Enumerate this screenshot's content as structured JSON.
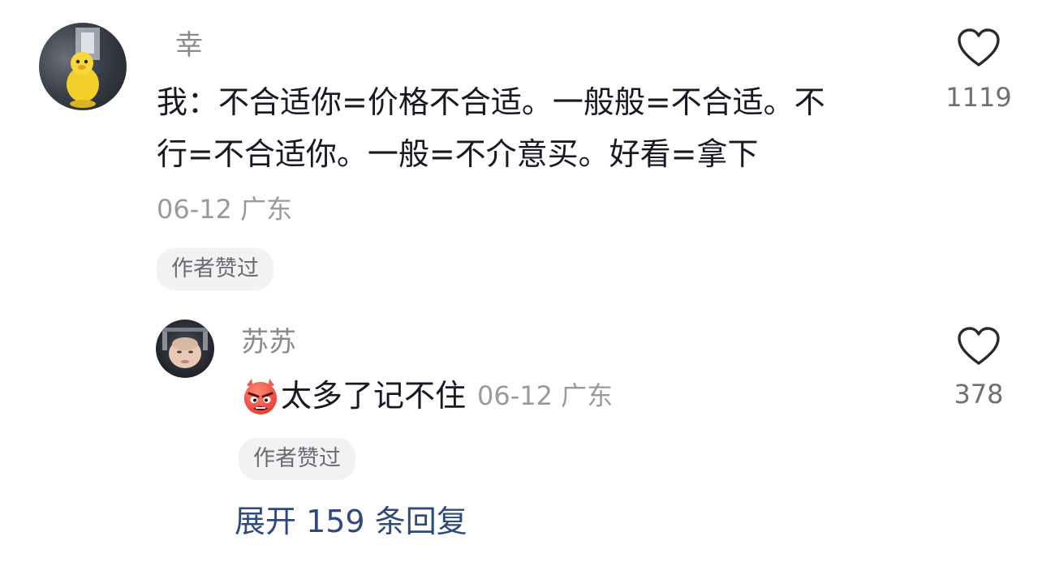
{
  "comment": {
    "username": "幸",
    "text_line1": "我：不合适你=价格不合适。一般般=不合适。不",
    "text_line2": "行=不合适你。一般=不介意买。好看=拿下",
    "meta": "06-12 广东",
    "author_liked": "作者赞过",
    "likes": "1119"
  },
  "reply": {
    "username": "苏苏",
    "text": "太多了记不住",
    "meta": "06-12 广东",
    "author_liked": "作者赞过",
    "likes": "378"
  },
  "expand_replies": "展开 159 条回复",
  "icons": {
    "heart": "heart-outline-icon",
    "emoji": "angry-devil-emoji"
  },
  "colors": {
    "text": "#161823",
    "secondary": "#8a8a8e",
    "link": "#2f4a7a",
    "chip_bg": "#f2f2f4"
  }
}
